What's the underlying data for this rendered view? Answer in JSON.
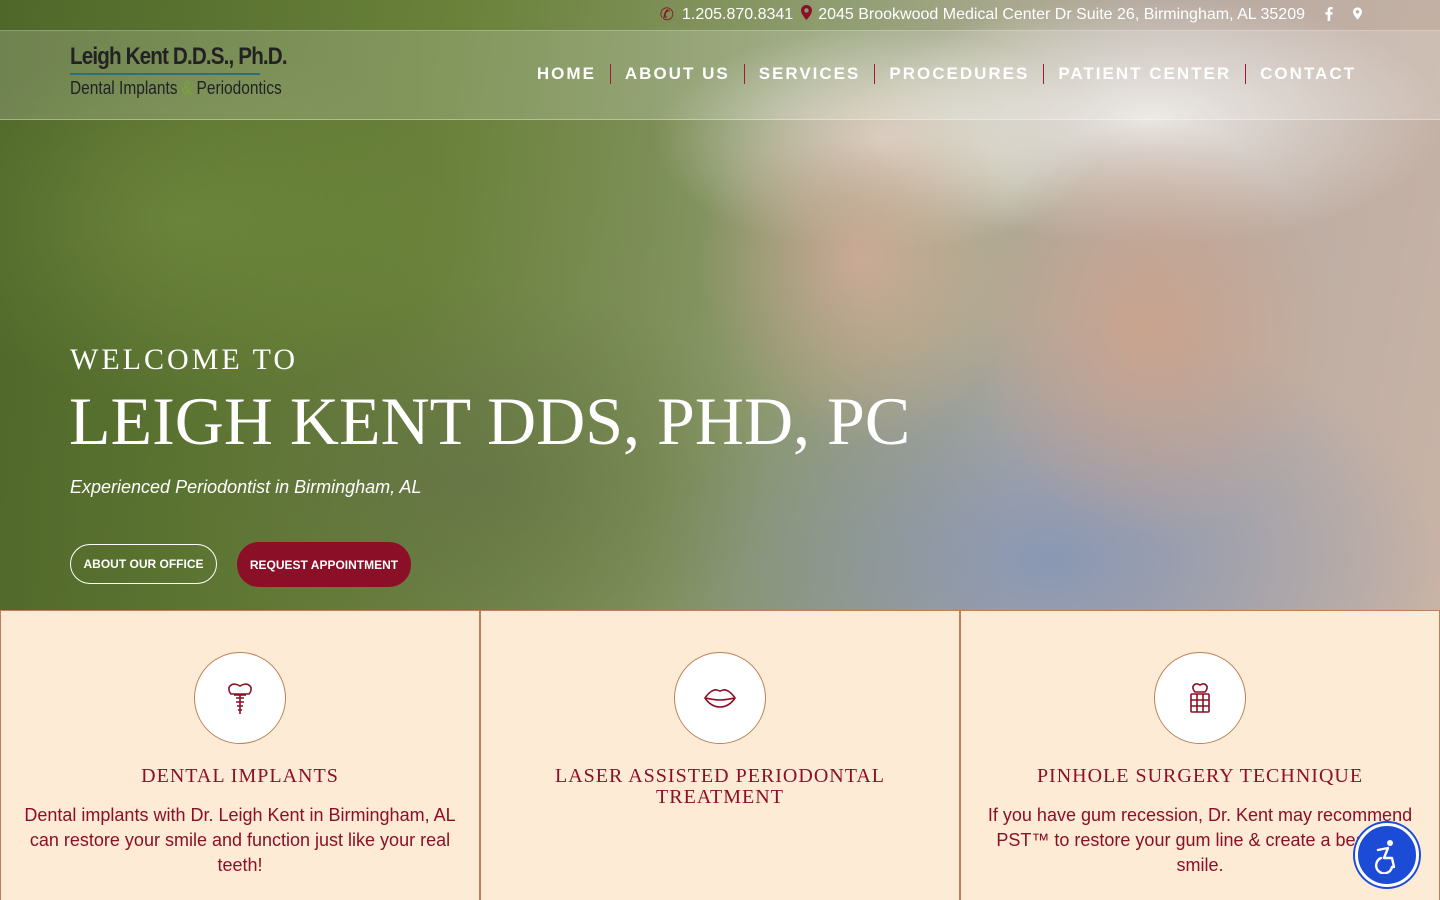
{
  "topbar": {
    "phone": "1.205.870.8341",
    "address": "2045 Brookwood Medical Center Dr Suite 26, Birmingham, AL 35209",
    "social": [
      "facebook-icon",
      "map-pin-icon"
    ]
  },
  "logo": {
    "line1": "Leigh Kent D.D.S., Ph.D.",
    "line2_a": "Dental Implants",
    "line2_amp": "&",
    "line2_b": "Periodontics"
  },
  "nav": {
    "items": [
      "HOME",
      "ABOUT US",
      "SERVICES",
      "PROCEDURES",
      "PATIENT CENTER",
      "CONTACT"
    ]
  },
  "hero": {
    "welcome": "WELCOME TO",
    "headline": "LEIGH KENT DDS, PHD, PC",
    "subhead": "Experienced Periodontist in Birmingham, AL",
    "btn_about": "ABOUT OUR OFFICE",
    "btn_request": "REQUEST APPOINTMENT"
  },
  "services": [
    {
      "icon": "dental-implant-icon",
      "title": "DENTAL IMPLANTS",
      "text": "Dental implants with Dr. Leigh Kent in Birmingham, AL can restore your smile and function just like your real teeth!"
    },
    {
      "icon": "lips-icon",
      "title": "LASER ASSISTED PERIODONTAL TREATMENT",
      "text": ""
    },
    {
      "icon": "tooth-gums-icon",
      "title": "PINHOLE SURGERY TECHNIQUE",
      "text": "If you have gum recession, Dr. Kent may recommend PST™ to restore your gum line & create a beautiful smile."
    }
  ],
  "colors": {
    "brand": "#8b0f26",
    "card_bg": "#fdebd5",
    "border": "#b98157",
    "a11y": "#1c4bd8"
  }
}
